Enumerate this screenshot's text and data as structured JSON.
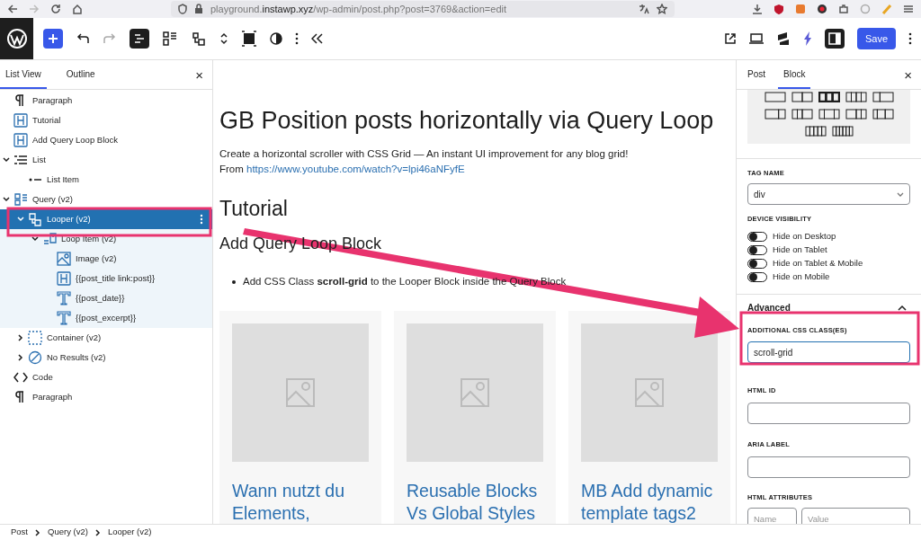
{
  "browser": {
    "url": {
      "subdomain": "playground.",
      "domain": "instawp.xyz",
      "path": "/wp-admin/post.php?post=3769&action=edit"
    }
  },
  "toolbar": {
    "save_label": "Save",
    "list_view_on": true,
    "settings_on": true
  },
  "left_panel": {
    "tabs": [
      {
        "label": "List View",
        "selected": true
      },
      {
        "label": "Outline",
        "selected": false
      }
    ],
    "close": "×",
    "tree": [
      {
        "label": "Paragraph",
        "kind": "paragraph",
        "selected": false
      },
      {
        "label": "Tutorial",
        "kind": "heading",
        "selected": false
      },
      {
        "label": "Add Query Loop Block",
        "kind": "heading",
        "selected": false
      },
      {
        "label": "List",
        "kind": "list",
        "selected": false,
        "expanded": true,
        "children": [
          {
            "label": "List Item",
            "kind": "listitem",
            "selected": false
          }
        ]
      },
      {
        "label": "Query (v2)",
        "kind": "query",
        "selected": false,
        "expanded": true,
        "children": [
          {
            "label": "Looper (v2)",
            "kind": "looper",
            "selected": true,
            "expanded": true,
            "children": [
              {
                "label": "Loop Item (v2)",
                "kind": "loopitem",
                "selected": false,
                "expanded": true,
                "children": [
                  {
                    "label": "Image (v2)",
                    "kind": "image",
                    "selected": false
                  },
                  {
                    "label": "{{post_title link:post}}",
                    "kind": "heading",
                    "selected": false
                  },
                  {
                    "label": "{{post_date}}",
                    "kind": "text",
                    "selected": false
                  },
                  {
                    "label": "{{post_excerpt}}",
                    "kind": "text",
                    "selected": false
                  }
                ]
              }
            ]
          },
          {
            "label": "Container (v2)",
            "kind": "container",
            "selected": false,
            "expanded": false
          },
          {
            "label": "No Results (v2)",
            "kind": "noresults",
            "selected": false,
            "expanded": false
          }
        ]
      },
      {
        "label": "Code",
        "kind": "code",
        "selected": false
      },
      {
        "label": "Paragraph",
        "kind": "paragraph",
        "selected": false
      }
    ]
  },
  "canvas": {
    "title": "GB Position posts horizontally via Query Loop",
    "intro": "Create a horizontal scroller with CSS Grid — An instant UI improvement for any blog grid!",
    "from_label": "From",
    "from_link": "https://www.youtube.com/watch?v=lpi46aNFyfE",
    "heading": "Tutorial",
    "subheading": "Add Query Loop Block",
    "bullets": [
      "Add CSS Class **scroll-grid** to the Looper Block inside the Query Block"
    ],
    "cards": [
      {
        "title": "Wann nutzt du Elements,"
      },
      {
        "title": "Reusable Blocks Vs Global Styles"
      },
      {
        "title": "MB Add dynamic template tags2"
      }
    ]
  },
  "right_panel": {
    "tabs": [
      {
        "label": "Post",
        "selected": false
      },
      {
        "label": "Block",
        "selected": true
      }
    ],
    "close": "×",
    "layout_options": [
      {
        "selected": false
      },
      {
        "selected": false
      },
      {
        "selected": true
      },
      {
        "selected": false
      },
      {
        "selected": false
      },
      {
        "selected": false
      },
      {
        "selected": false
      },
      {
        "selected": false
      },
      {
        "selected": false
      },
      {
        "selected": false
      },
      {
        "selected": false
      },
      {
        "selected": false
      }
    ],
    "tag_name": {
      "label": "TAG NAME",
      "value": "div"
    },
    "device_visibility": {
      "label": "DEVICE VISIBILITY",
      "toggles": [
        {
          "label": "Hide on Desktop",
          "on": false
        },
        {
          "label": "Hide on Tablet",
          "on": false
        },
        {
          "label": "Hide on Tablet & Mobile",
          "on": false
        },
        {
          "label": "Hide on Mobile",
          "on": false
        }
      ]
    },
    "advanced": {
      "title": "Advanced",
      "expanded": true,
      "css_classes": {
        "label": "ADDITIONAL CSS CLASS(ES)",
        "value": "scroll-grid"
      },
      "html_id": {
        "label": "HTML ID"
      },
      "aria_label": {
        "label": "ARIA LABEL"
      },
      "html_attributes": {
        "label": "HTML ATTRIBUTES",
        "name_placeholder": "Name",
        "value_placeholder": "Value"
      }
    }
  },
  "breadcrumb": [
    "Post",
    "Query (v2)",
    "Looper (v2)"
  ]
}
